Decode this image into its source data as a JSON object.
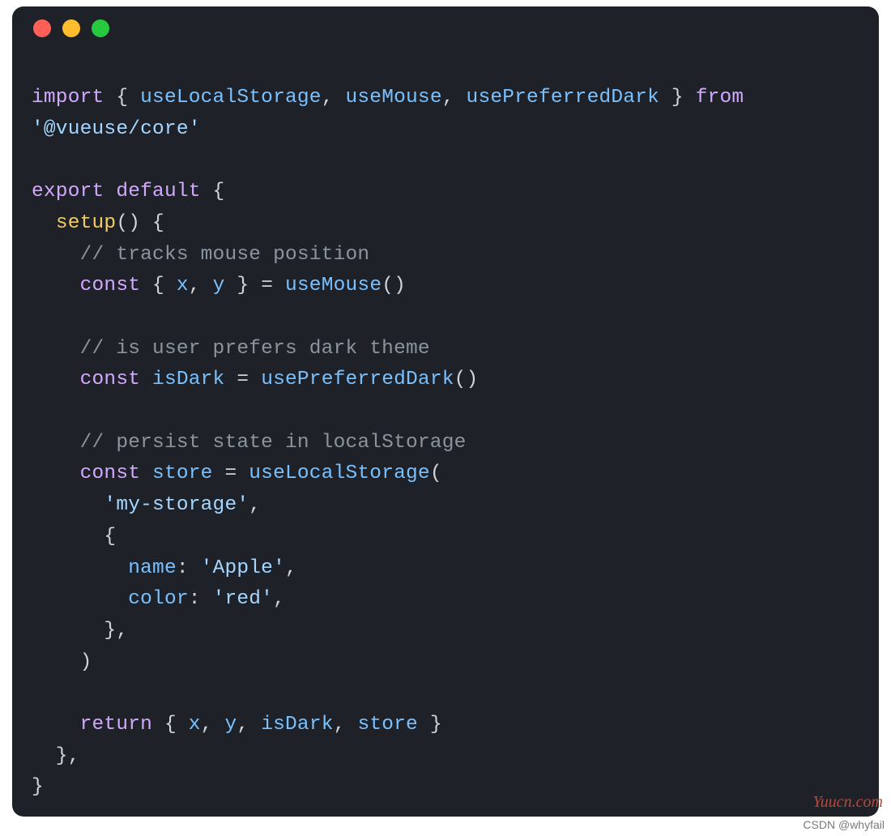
{
  "window": {
    "traffic_lights": [
      "red",
      "yellow",
      "green"
    ]
  },
  "code": {
    "kw_import": "import",
    "kw_from": "from",
    "kw_export": "export",
    "kw_default": "default",
    "kw_const": "const",
    "kw_return": "return",
    "fn_useLocalStorage": "useLocalStorage",
    "fn_useMouse": "useMouse",
    "fn_usePreferredDark": "usePreferredDark",
    "str_pkg": "'@vueuse/core'",
    "fn_setup": "setup",
    "com_mouse": "// tracks mouse position",
    "id_x": "x",
    "id_y": "y",
    "com_dark": "// is user prefers dark theme",
    "id_isDark": "isDark",
    "com_storage": "// persist state in localStorage",
    "id_store": "store",
    "str_key": "'my-storage'",
    "prop_name": "name",
    "str_apple": "'Apple'",
    "prop_color": "color",
    "str_red": "'red'"
  },
  "watermark_site": "Yuucn.com",
  "watermark_csdn": "CSDN @whyfail"
}
